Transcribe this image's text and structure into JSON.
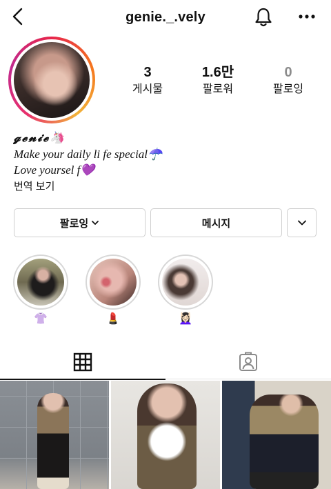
{
  "header": {
    "username": "genie._.vely",
    "back_icon": "chevron-left-icon",
    "notify_icon": "bell-icon",
    "more_icon": "ellipsis-icon"
  },
  "stats": [
    {
      "value": "3",
      "label": "게시물"
    },
    {
      "value": "1.6만",
      "label": "팔로워"
    },
    {
      "value": "0",
      "label": "팔로잉"
    }
  ],
  "bio": {
    "name": "𝓰𝓮𝓷𝓲𝓮",
    "name_emoji": "🦄",
    "line1": "Make your daily li fe special",
    "line1_emoji": "☂️",
    "line2": "Love yoursel f",
    "line2_emoji": "💜",
    "translate": "번역 보기"
  },
  "actions": {
    "following_label": "팔로잉",
    "message_label": "메시지"
  },
  "highlights": [
    {
      "emoji": "👚"
    },
    {
      "emoji": "💄"
    },
    {
      "emoji": "💆🏻‍♀️"
    }
  ],
  "tabs": [
    {
      "icon": "grid-icon",
      "active": true
    },
    {
      "icon": "tagged-icon",
      "active": false
    }
  ],
  "colors": {
    "story_ring": [
      "#e7254b",
      "#f5761e",
      "#c12a8e"
    ],
    "border": "#cfcfcf",
    "muted": "#8c8c8c"
  }
}
